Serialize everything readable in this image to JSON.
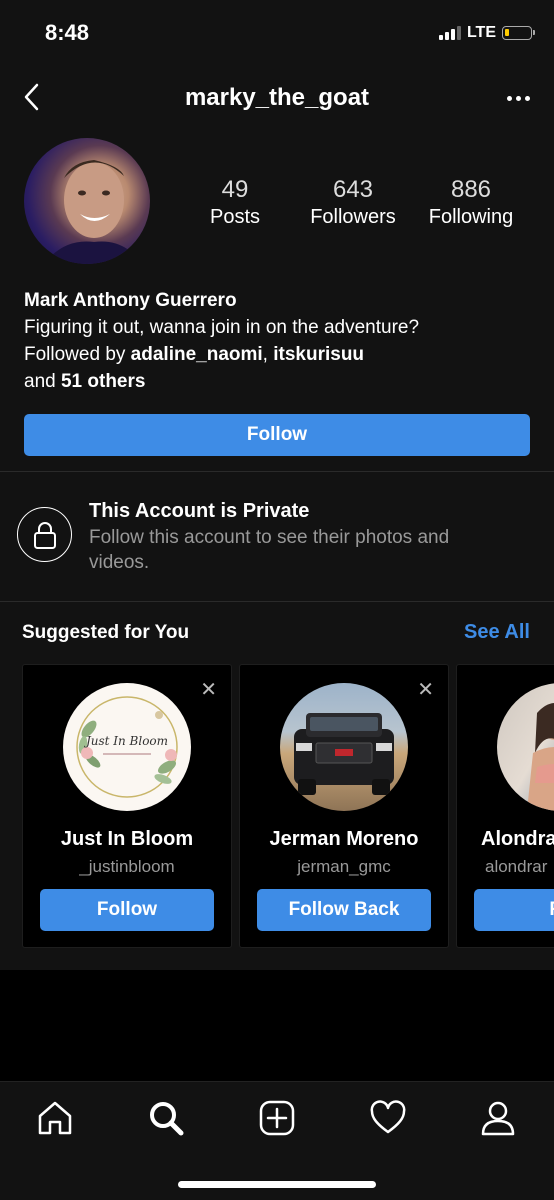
{
  "status": {
    "time": "8:48",
    "network": "LTE"
  },
  "nav": {
    "username": "marky_the_goat"
  },
  "profile": {
    "stats": [
      {
        "value": "49",
        "label": "Posts"
      },
      {
        "value": "643",
        "label": "Followers"
      },
      {
        "value": "886",
        "label": "Following"
      }
    ],
    "full_name": "Mark Anthony Guerrero",
    "bio": "Figuring it out, wanna join in on the adventure?",
    "followed_by_prefix": "Followed by",
    "followed_by_1": "adaline_naomi",
    "followed_by_sep": ",",
    "followed_by_2": "itskurisuu",
    "followed_by_and": "and",
    "followed_by_others": "51 others",
    "follow_label": "Follow"
  },
  "private": {
    "title": "This Account is Private",
    "subtitle": "Follow this account to see their photos and videos."
  },
  "suggested": {
    "title": "Suggested for You",
    "see_all": "See All",
    "cards": [
      {
        "name": "Just In Bloom",
        "handle": "_justinbloom",
        "button": "Follow",
        "logo_text": "Just In Bloom"
      },
      {
        "name": "Jerman Moreno",
        "handle": "jerman_gmc",
        "button": "Follow Back"
      },
      {
        "name": "Alondra",
        "handle": "alondrar",
        "button": "Fo"
      }
    ]
  },
  "icons": {
    "back": "chevron-left-icon",
    "more": "more-horizontal-icon",
    "lock": "lock-icon",
    "close": "close-icon",
    "tabs": [
      "home-icon",
      "search-icon",
      "add-post-icon",
      "heart-icon",
      "profile-icon"
    ]
  },
  "colors": {
    "accent": "#3e8ce6",
    "background": "#121212"
  }
}
